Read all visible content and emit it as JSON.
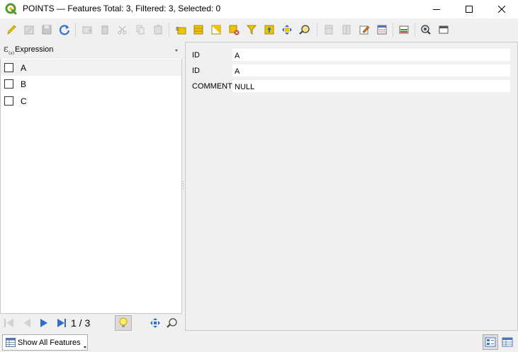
{
  "window": {
    "title": "POINTS — Features Total: 3, Filtered: 3, Selected: 0"
  },
  "colors": {
    "qgis_green": "#589632",
    "qgis_yellow": "#f0c400",
    "accent_blue": "#2f6fcf",
    "selected_row": "#f2f2f2"
  },
  "toolbar": {
    "icons": [
      "pencil-icon",
      "multi-edit-icon",
      "save-edits-icon",
      "reload-icon",
      "add-feature-icon",
      "delete-feature-icon",
      "cut-icon",
      "copy-icon",
      "paste-icon",
      "select-by-expression-icon",
      "select-all-icon",
      "invert-selection-icon",
      "deselect-all-icon",
      "filter-icon",
      "move-selection-to-top-icon",
      "pan-to-selected-icon",
      "zoom-to-selected-icon",
      "new-field-icon",
      "delete-field-icon",
      "toggle-edit-icon",
      "field-calculator-icon",
      "conditional-formatting-icon",
      "actions-icon",
      "dock-icon"
    ]
  },
  "expression": {
    "label": "Expression"
  },
  "features": {
    "items": [
      {
        "label": "A",
        "checked": false,
        "selected": true
      },
      {
        "label": "B",
        "checked": false,
        "selected": false
      },
      {
        "label": "C",
        "checked": false,
        "selected": false
      }
    ]
  },
  "form": {
    "rows": [
      {
        "label": "ID",
        "value": "A"
      },
      {
        "label": "ID",
        "value": "A"
      },
      {
        "label": "COMMENT",
        "value": "NULL"
      }
    ]
  },
  "navigation": {
    "counter": "1 / 3"
  },
  "statusbar": {
    "show_all_label": "Show All Features"
  }
}
